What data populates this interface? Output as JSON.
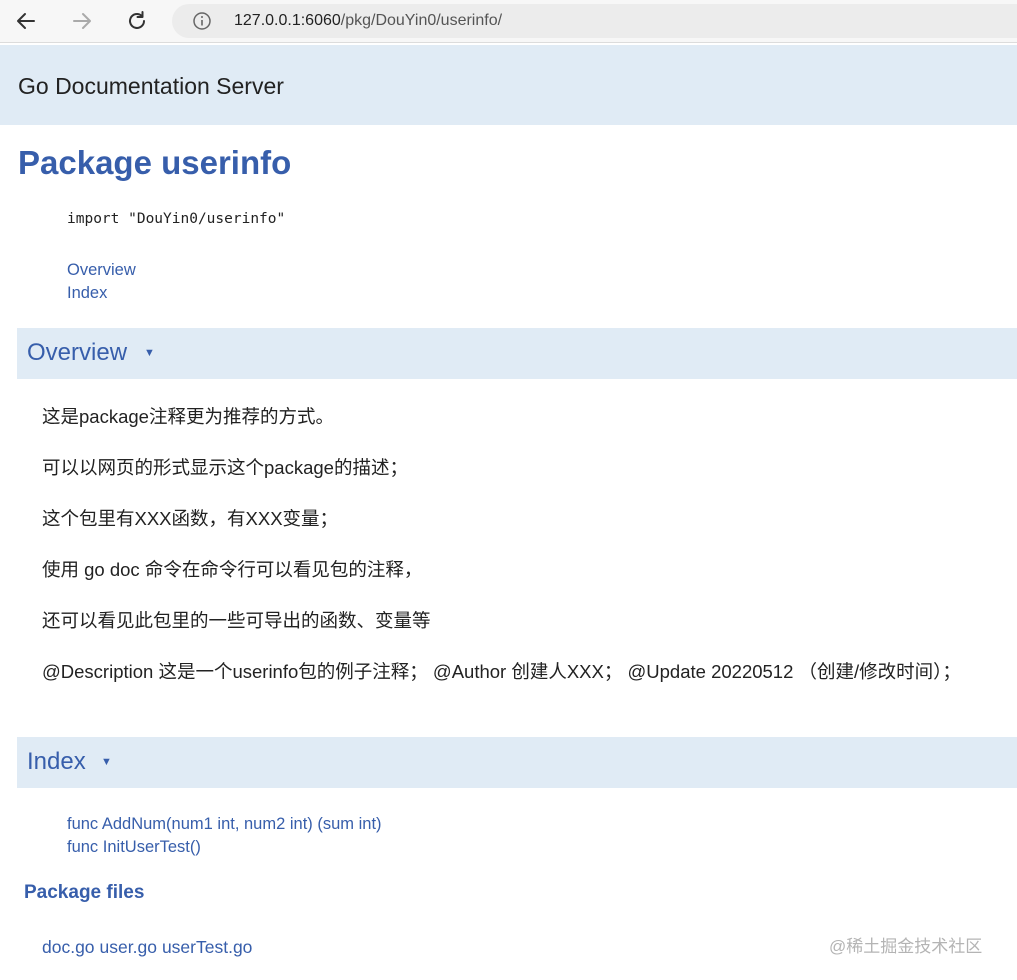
{
  "browser": {
    "url_host": "127.0.0.1:6060",
    "url_path": "/pkg/DouYin0/userinfo/"
  },
  "topbar": {
    "title": "Go Documentation Server"
  },
  "package": {
    "title": "Package userinfo",
    "import": "import \"DouYin0/userinfo\""
  },
  "toc": [
    "Overview",
    "Index"
  ],
  "overview": {
    "heading": "Overview",
    "arrow": "▼",
    "paragraphs": [
      "这是package注释更为推荐的方式。",
      "可以以网页的形式显示这个package的描述；",
      "这个包里有XXX函数，有XXX变量；",
      "使用 go doc 命令在命令行可以看见包的注释，",
      "还可以看见此包里的一些可导出的函数、变量等",
      "@Description 这是一个userinfo包的例子注释； @Author 创建人XXX； @Update 20220512 （创建/修改时间）；"
    ]
  },
  "index": {
    "heading": "Index",
    "arrow": "▼",
    "items": [
      "func AddNum(num1 int, num2 int) (sum int)",
      "func InitUserTest()"
    ]
  },
  "package_files": {
    "heading": "Package files",
    "files": [
      "doc.go",
      "user.go",
      "userTest.go"
    ]
  },
  "watermark": "@稀土掘金技术社区"
}
